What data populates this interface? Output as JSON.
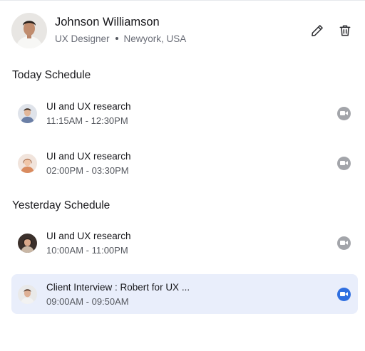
{
  "profile": {
    "name": "Johnson Williamson",
    "role": "UX Designer",
    "location": "Newyork, USA"
  },
  "sections": {
    "today": "Today Schedule",
    "yesterday": "Yesterday Schedule"
  },
  "today_items": [
    {
      "title": "UI and UX research",
      "time": "11:15AM - 12:30PM"
    },
    {
      "title": "UI and UX research",
      "time": "02:00PM - 03:30PM"
    }
  ],
  "yesterday_items": [
    {
      "title": "UI and UX research",
      "time": "10:00AM - 11:00PM"
    },
    {
      "title": "Client Interview : Robert for UX ...",
      "time": "09:00AM - 09:50AM"
    }
  ],
  "icons": {
    "edit": "pencil-icon",
    "delete": "trash-icon",
    "video": "video-camera-icon"
  },
  "colors": {
    "active_row": "#e9eefb",
    "active_video": "#2f6fe0",
    "inactive_video": "#a3a5aa"
  }
}
